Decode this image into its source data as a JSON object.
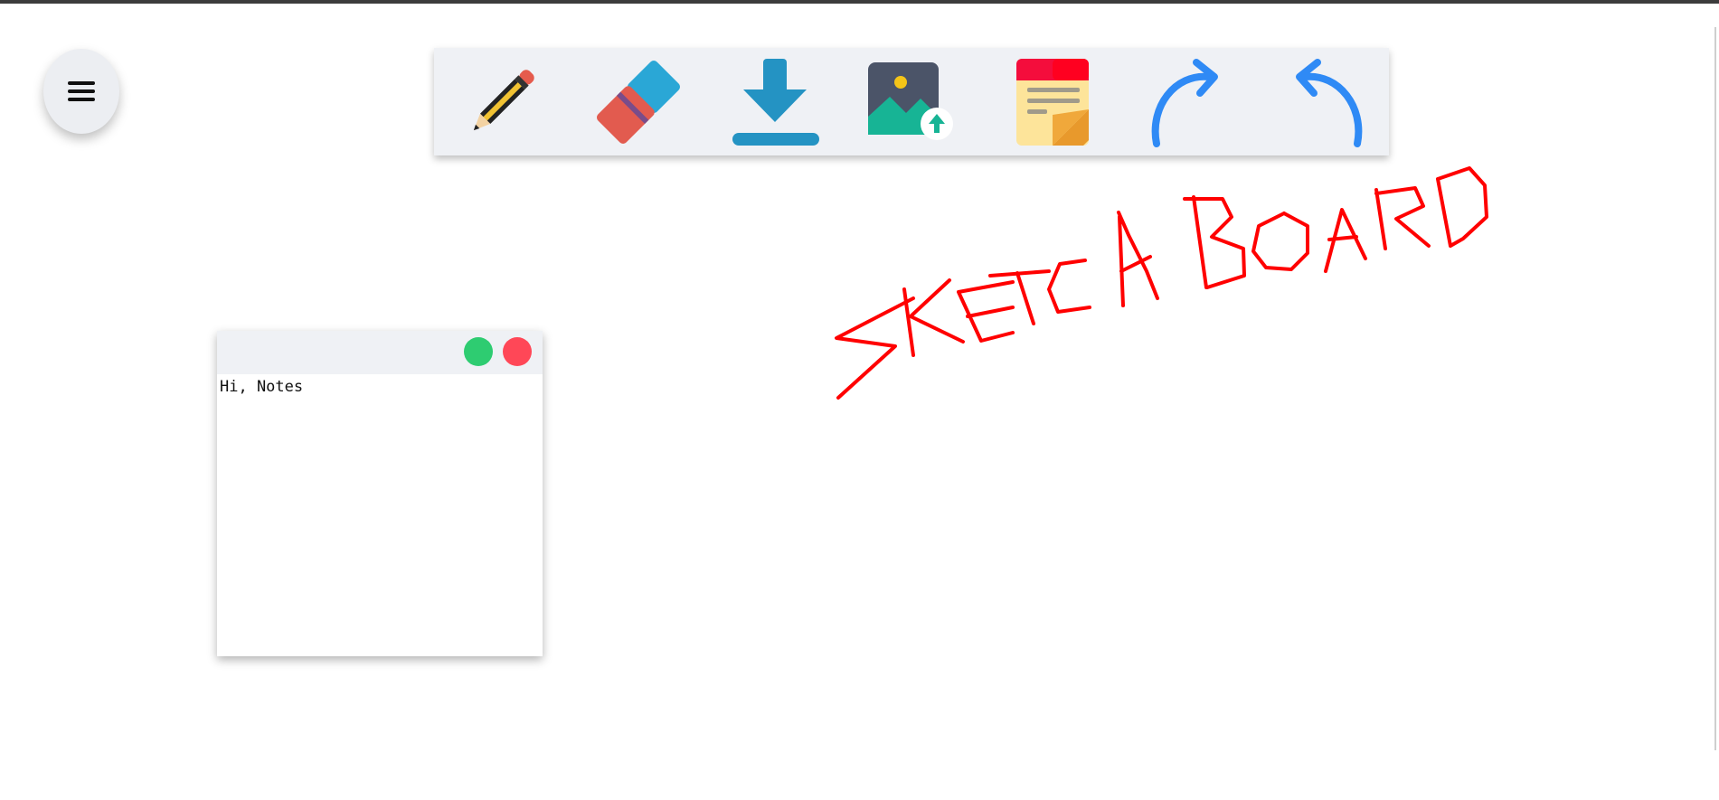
{
  "menu": {
    "icon": "hamburger-icon"
  },
  "toolbar": {
    "tools": [
      {
        "name": "pencil",
        "icon": "pencil-icon"
      },
      {
        "name": "eraser",
        "icon": "eraser-icon"
      },
      {
        "name": "download",
        "icon": "download-icon"
      },
      {
        "name": "upload-image",
        "icon": "image-upload-icon"
      },
      {
        "name": "sticky-note",
        "icon": "sticky-note-icon"
      },
      {
        "name": "redo",
        "icon": "redo-icon"
      },
      {
        "name": "undo",
        "icon": "undo-icon"
      }
    ],
    "background_color": "#eff1f5"
  },
  "canvas": {
    "stroke_color": "#ff0000"
  },
  "note": {
    "text": "Hi, Notes",
    "header_color": "#eff1f5",
    "green_button_color": "#2ecc71",
    "red_button_color": "#ff4757"
  },
  "colors": {
    "accent_blue": "#2f8af5",
    "download_blue": "#2493c3"
  }
}
